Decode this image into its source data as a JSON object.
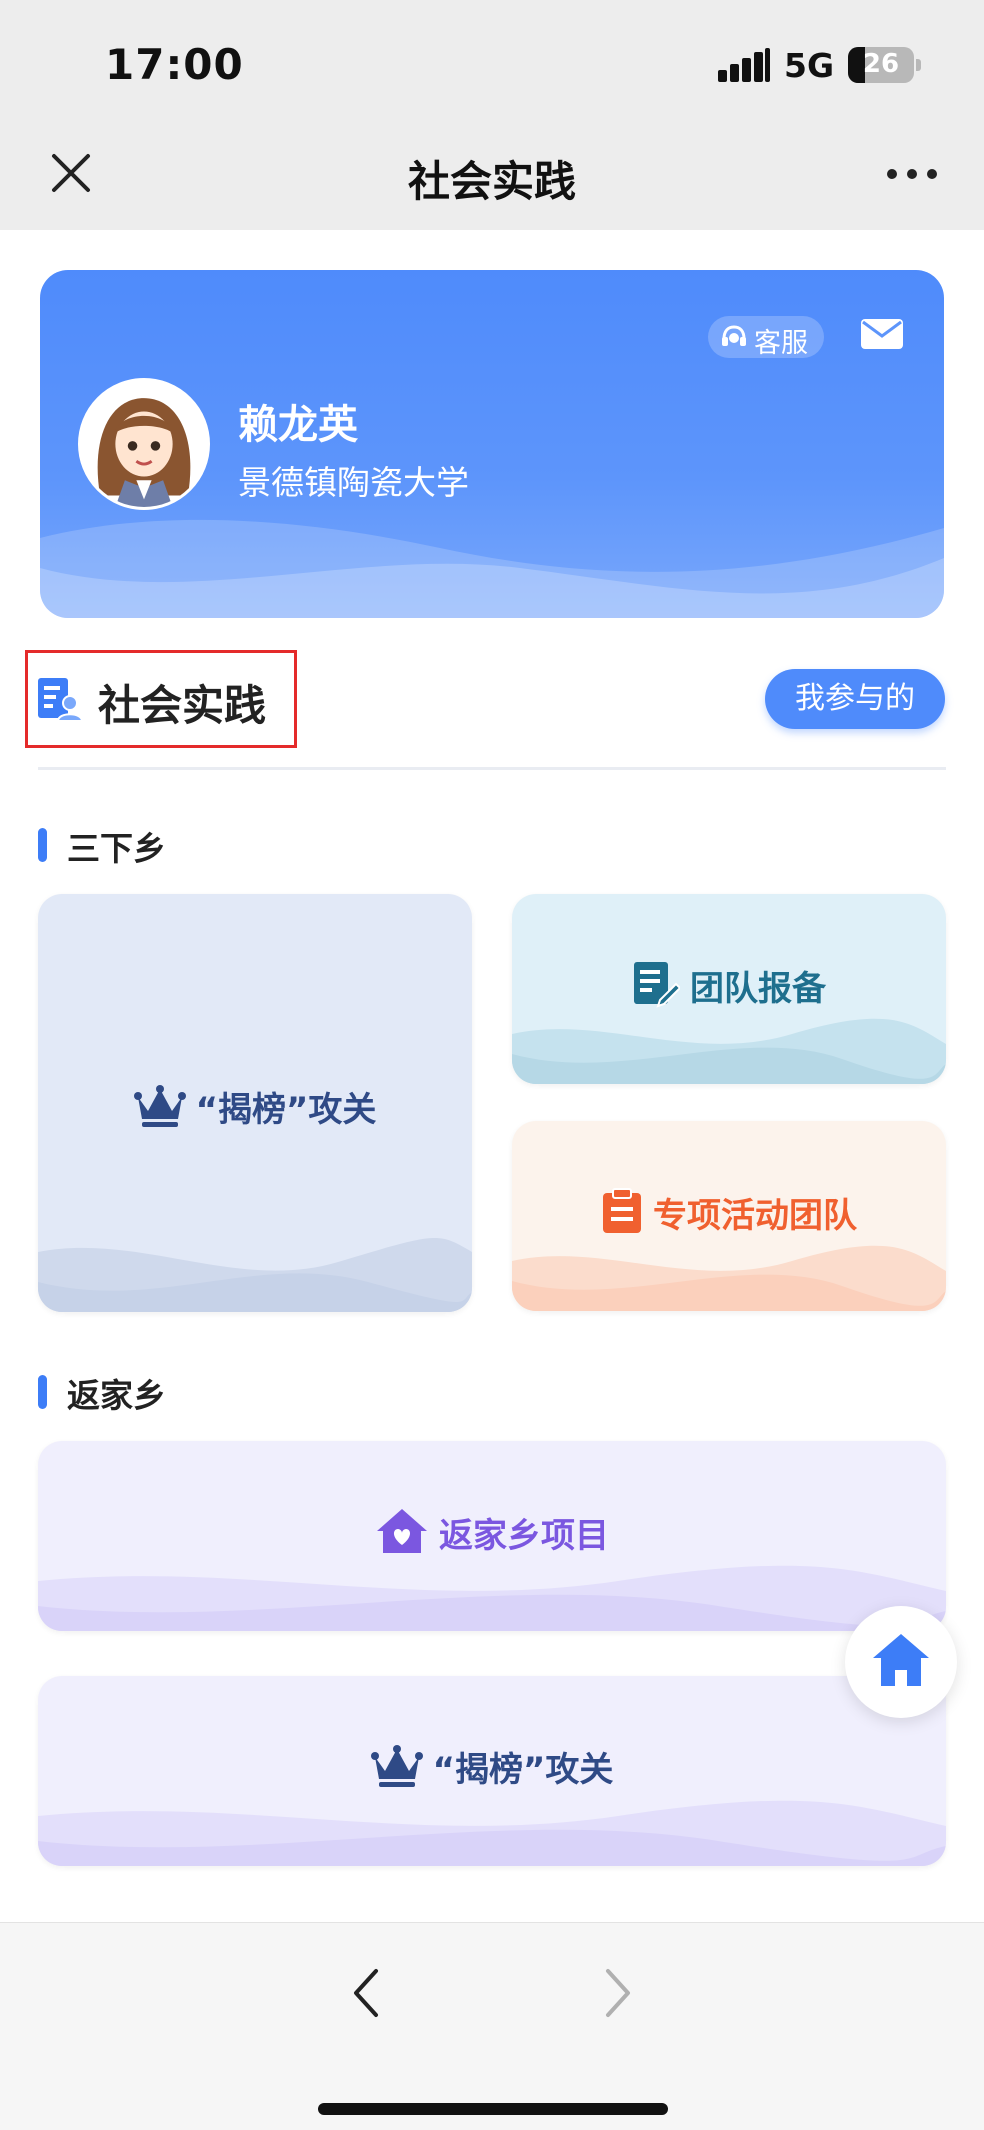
{
  "status_bar": {
    "time": "17:00",
    "network": "5G",
    "battery": "26"
  },
  "nav": {
    "title": "社会实践"
  },
  "profile": {
    "service_label": "客服",
    "name": "赖龙英",
    "school": "景德镇陶瓷大学"
  },
  "section": {
    "title": "社会实践",
    "mine_button": "我参与的"
  },
  "sanxiaxiang": {
    "heading": "三下乡",
    "cards": {
      "jiebang": "“揭榜”攻关",
      "team_register": "团队报备",
      "special_team": "专项活动团队"
    }
  },
  "fanjiaxiang": {
    "heading": "返家乡",
    "cards": {
      "project": "返家乡项目",
      "jiebang": "“揭榜”攻关"
    }
  },
  "colors": {
    "accent": "#4f8bfb",
    "highlight_border": "#e42a2a",
    "team_register_text": "#1e6f8e",
    "special_team_text": "#f0602f",
    "jiebang_text": "#2f4a86",
    "project_text": "#7b57e0"
  },
  "icons": [
    "close-icon",
    "more-icon",
    "headset-icon",
    "mail-icon",
    "section-document-user-icon",
    "crown-icon",
    "edit-document-icon",
    "clipboard-icon",
    "home-heart-icon",
    "home-icon",
    "back-icon",
    "forward-icon"
  ]
}
